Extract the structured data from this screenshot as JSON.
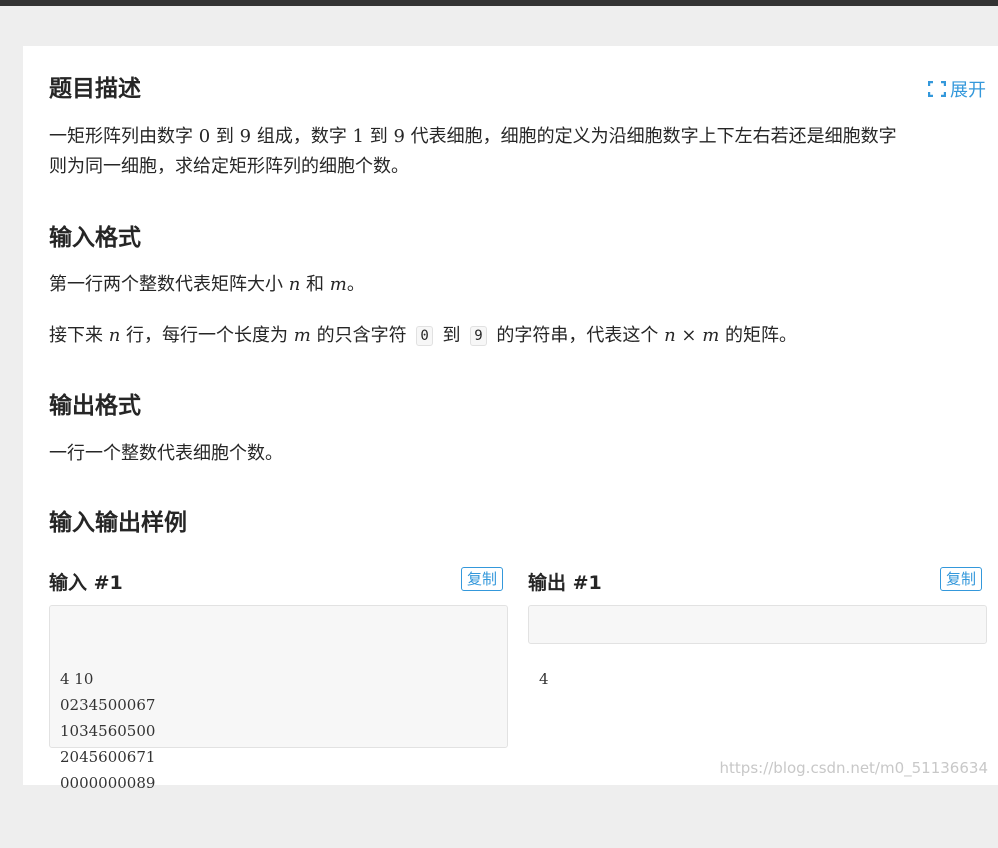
{
  "expand_label": "展开",
  "description": {
    "heading": "题目描述",
    "line1": {
      "t1": "一矩形阵列由数字 ",
      "m1": "0",
      "t2": " 到 ",
      "m2": "9",
      "t3": " 组成，数字 ",
      "m3": "1",
      "t4": " 到 ",
      "m4": "9",
      "t5": " 代表细胞，细胞的定义为沿细胞数字上下左右若还是细胞数字"
    },
    "line2": "则为同一细胞，求给定矩形阵列的细胞个数。"
  },
  "input_format": {
    "heading": "输入格式",
    "p1": {
      "t1": "第一行两个整数代表矩阵大小 ",
      "m1": "n",
      "t2": " 和 ",
      "m2": "m",
      "t3": "。"
    },
    "p2": {
      "t1": "接下来 ",
      "m1": "n",
      "t2": " 行，每行一个长度为 ",
      "m2": "m",
      "t3": " 的只含字符 ",
      "c1": "0",
      "t4": " 到 ",
      "c2": "9",
      "t5": " 的字符串，代表这个 ",
      "m3": "n",
      "m_times": "×",
      "m4": "m",
      "t6": " 的矩阵。"
    }
  },
  "output_format": {
    "heading": "输出格式",
    "p1": "一行一个整数代表细胞个数。"
  },
  "samples": {
    "heading": "输入输出样例",
    "input_title": "输入 #1",
    "output_title": "输出 #1",
    "copy_label": "复制",
    "input_lines": [
      "4 10",
      "0234500067",
      "1034560500",
      "2045600671",
      "0000000089"
    ],
    "output_lines": [
      "4"
    ]
  },
  "watermark": "https://blog.csdn.net/m0_51136634",
  "colors": {
    "accent": "#3498db",
    "page_bg": "#eeeeee",
    "card_bg": "#ffffff",
    "code_bg": "#f7f7f7",
    "topbar": "#333333"
  }
}
